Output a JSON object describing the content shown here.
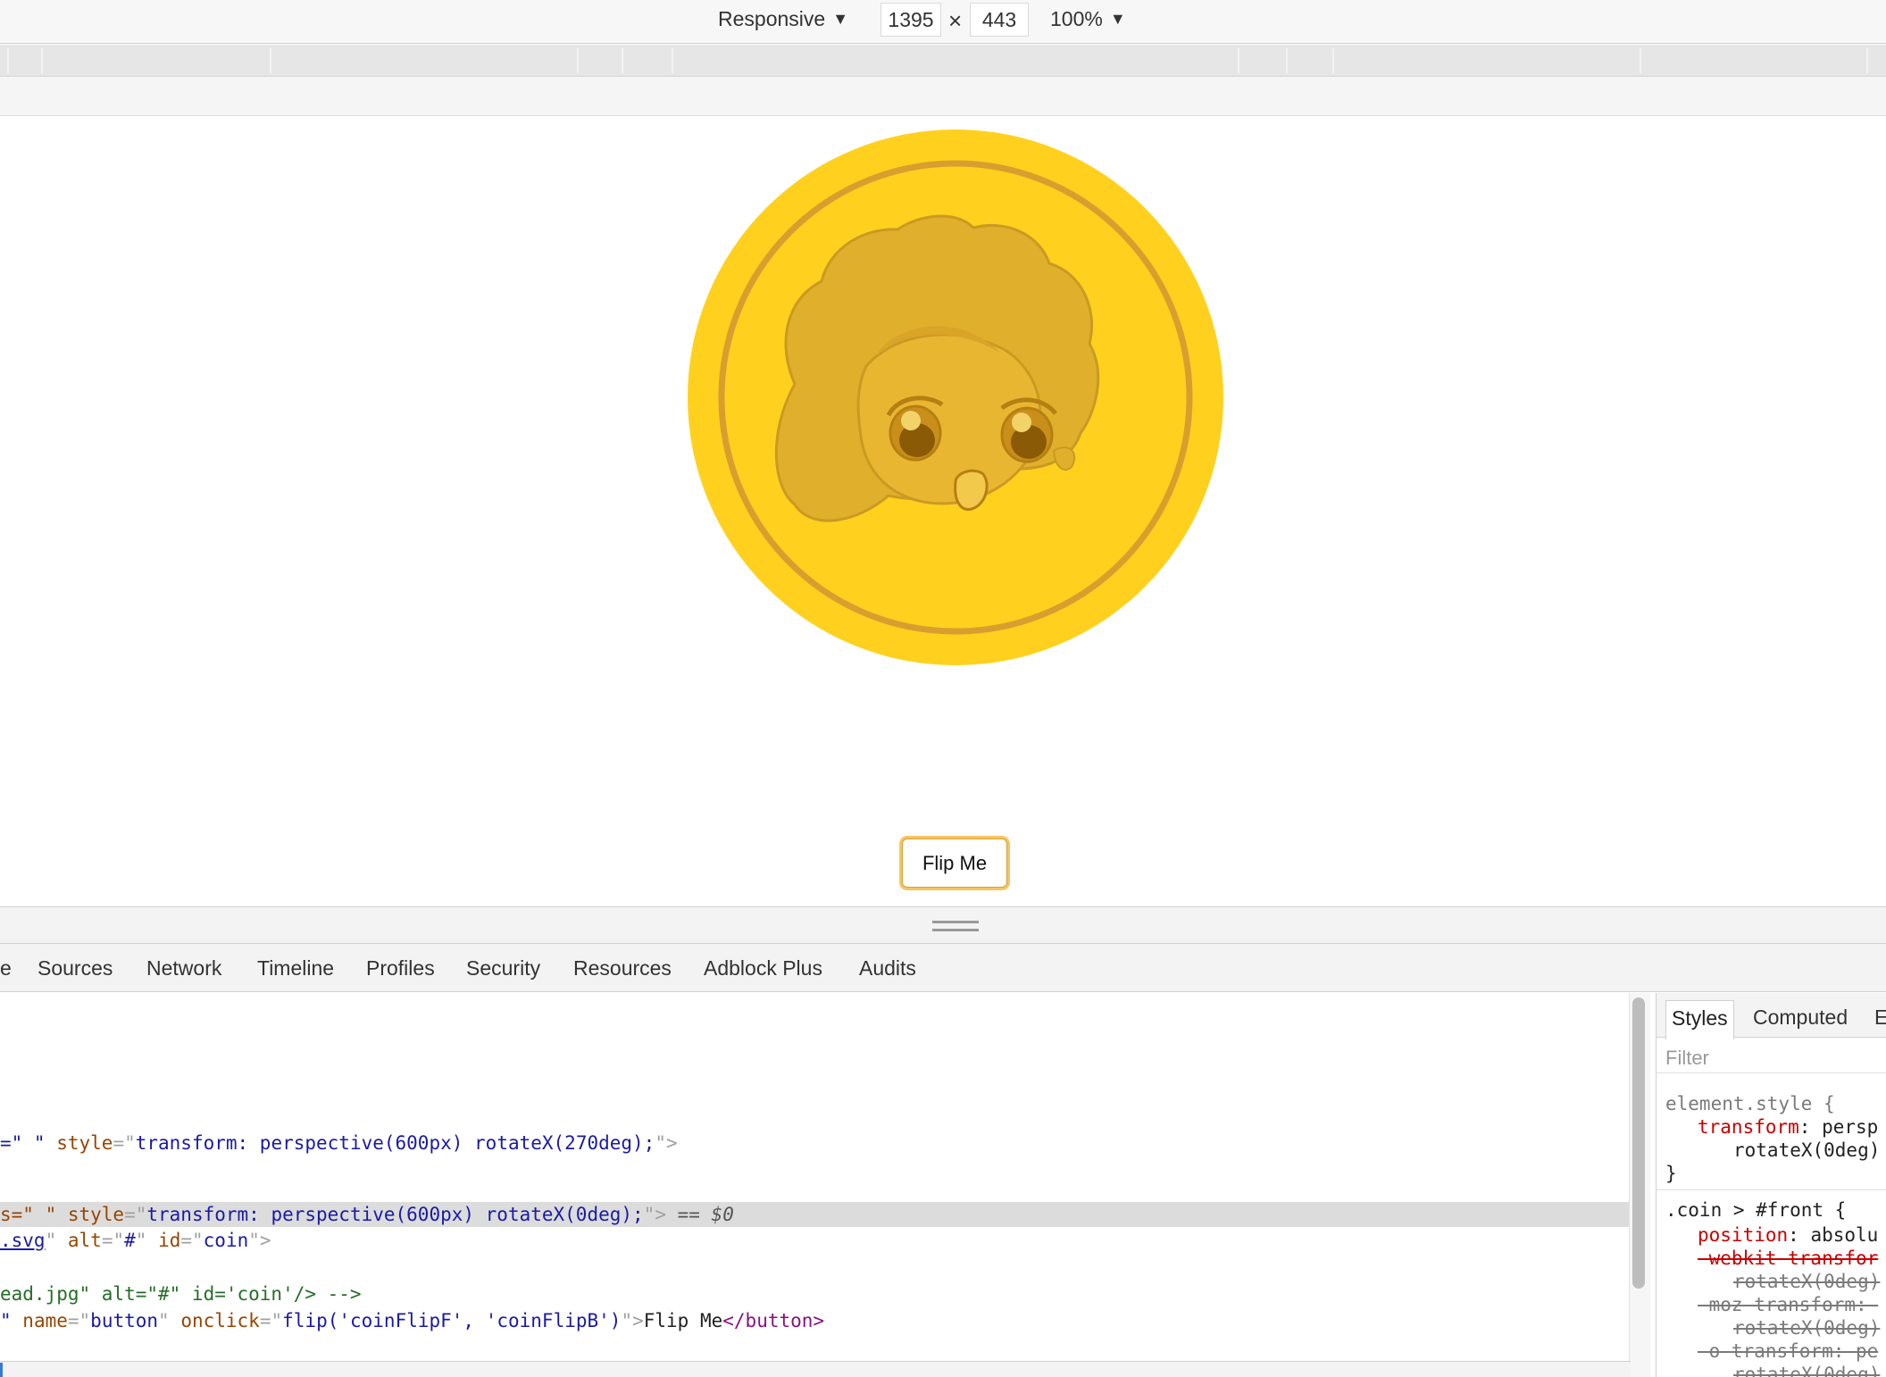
{
  "device_toolbar": {
    "device": "Responsive",
    "width": "1395",
    "times": "×",
    "height": "443",
    "zoom": "100%",
    "caret": "▼"
  },
  "page": {
    "button_label": "Flip Me",
    "coin": {
      "face_color": "#FFD11E",
      "ring_color": "#D99E2E",
      "hair_color": "#E0AF2C"
    }
  },
  "devtools": {
    "tabs": [
      "e",
      "Sources",
      "Network",
      "Timeline",
      "Profiles",
      "Security",
      "Resources",
      "Adblock Plus",
      "Audits"
    ],
    "elements": {
      "line1": {
        "a": "=\" \" ",
        "attr": "style",
        "eq": "=\"",
        "val": "transform: perspective(600px) rotateX(270deg);",
        "close": "\">"
      },
      "line2": {
        "a": "s=\" \" ",
        "attr": "style",
        "eq": "=\"",
        "val": "transform: perspective(600px) rotateX(0deg);",
        "close": "\">",
        "marker": " == ",
        "dollar": "$0"
      },
      "line3": {
        "link": ".svg",
        "rest_attr1": "alt",
        "rest_val1": "#",
        "rest_attr2": "id",
        "rest_val2": "coin"
      },
      "line4": {
        "comment": "ead.jpg\" alt=\"#\" id='coin'/> -->"
      },
      "line5": {
        "a": "\" ",
        "attr1": "name",
        "val1": "button",
        "attr2": "onclick",
        "val2": "flip('coinFlipF', 'coinFlipB')",
        "text": "Flip Me",
        "closetag": "button"
      }
    },
    "sidebar": {
      "tabs": [
        "Styles",
        "Computed",
        "E"
      ],
      "filter_placeholder": "Filter",
      "rule1_selector": "element.style {",
      "rule1_prop": "transform",
      "rule1_val": ": persp",
      "rule1_val2": "rotateX(0deg)",
      "rule1_close": "}",
      "rule2_selector": ".coin > #front {",
      "rule2_prop1": "position",
      "rule2_val1": ": absolu",
      "rule2_prop2": "-webkit-transfor",
      "rule2_val2": "rotateX(0deg)",
      "rule2_prop3": "-moz-transform: ",
      "rule2_val3": "rotateX(0deg)",
      "rule2_prop4": "-o-transform: pe",
      "rule2_val4": "rotateX(0deg)"
    }
  }
}
